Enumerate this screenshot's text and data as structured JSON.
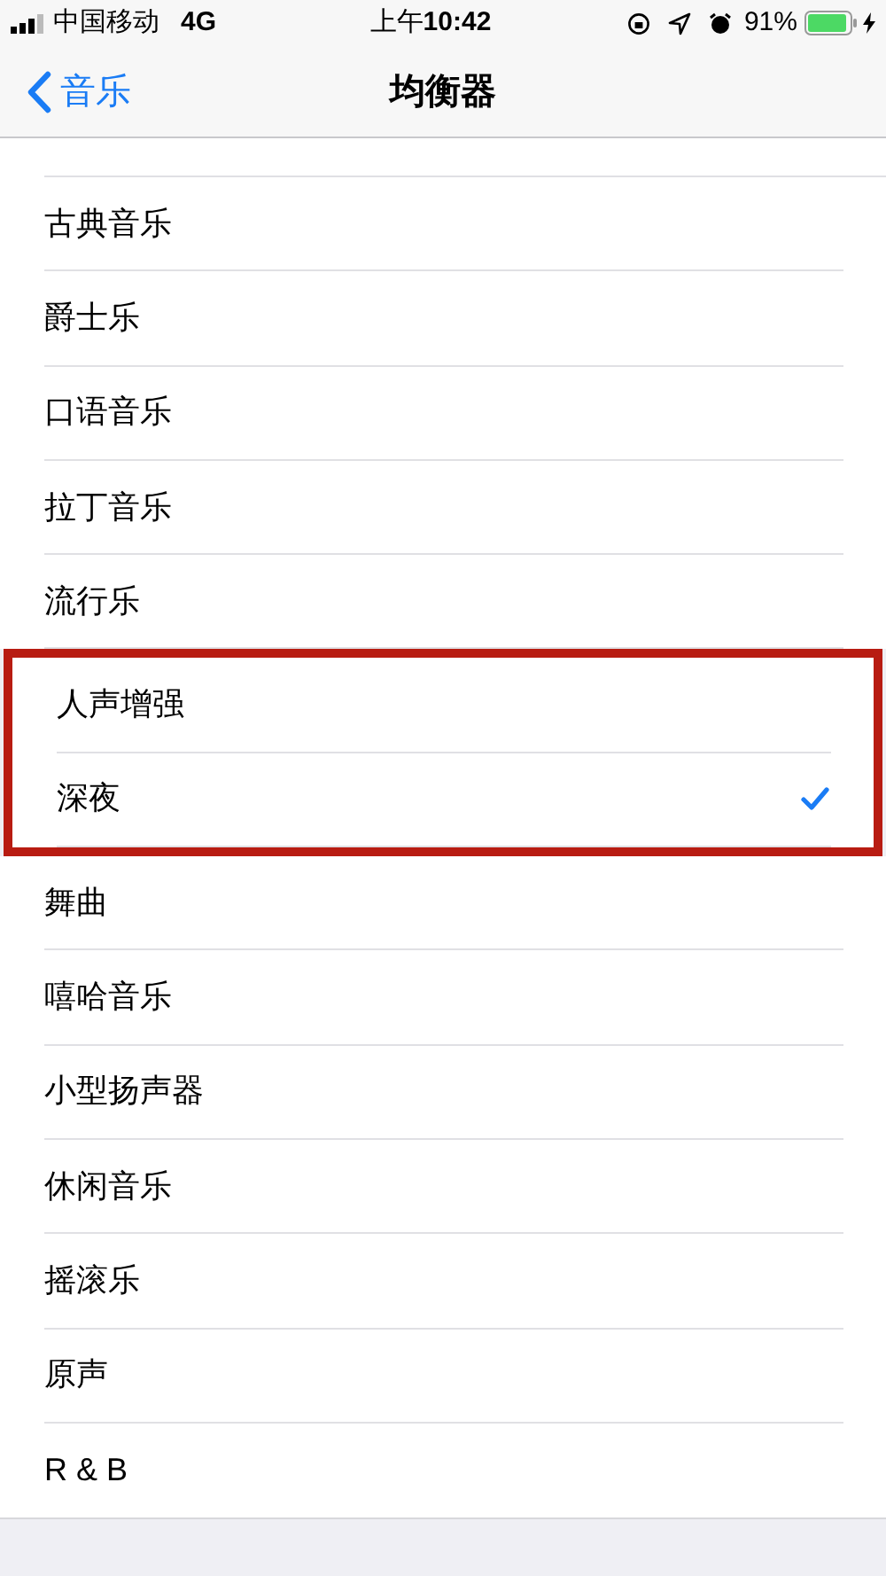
{
  "status_bar": {
    "carrier": "中国移动",
    "network": "4G",
    "time_prefix": "上午",
    "time": "10:42",
    "battery": "91%"
  },
  "nav": {
    "back": "音乐",
    "title": "均衡器"
  },
  "items": [
    {
      "label": "古典音乐",
      "selected": false,
      "highlighted": false
    },
    {
      "label": "爵士乐",
      "selected": false,
      "highlighted": false
    },
    {
      "label": "口语音乐",
      "selected": false,
      "highlighted": false
    },
    {
      "label": "拉丁音乐",
      "selected": false,
      "highlighted": false
    },
    {
      "label": "流行乐",
      "selected": false,
      "highlighted": false
    },
    {
      "label": "人声增强",
      "selected": false,
      "highlighted": true
    },
    {
      "label": "深夜",
      "selected": true,
      "highlighted": true
    },
    {
      "label": "舞曲",
      "selected": false,
      "highlighted": false
    },
    {
      "label": "嘻哈音乐",
      "selected": false,
      "highlighted": false
    },
    {
      "label": "小型扬声器",
      "selected": false,
      "highlighted": false
    },
    {
      "label": "休闲音乐",
      "selected": false,
      "highlighted": false
    },
    {
      "label": "摇滚乐",
      "selected": false,
      "highlighted": false
    },
    {
      "label": "原声",
      "selected": false,
      "highlighted": false
    },
    {
      "label": "R & B",
      "selected": false,
      "highlighted": false
    }
  ]
}
